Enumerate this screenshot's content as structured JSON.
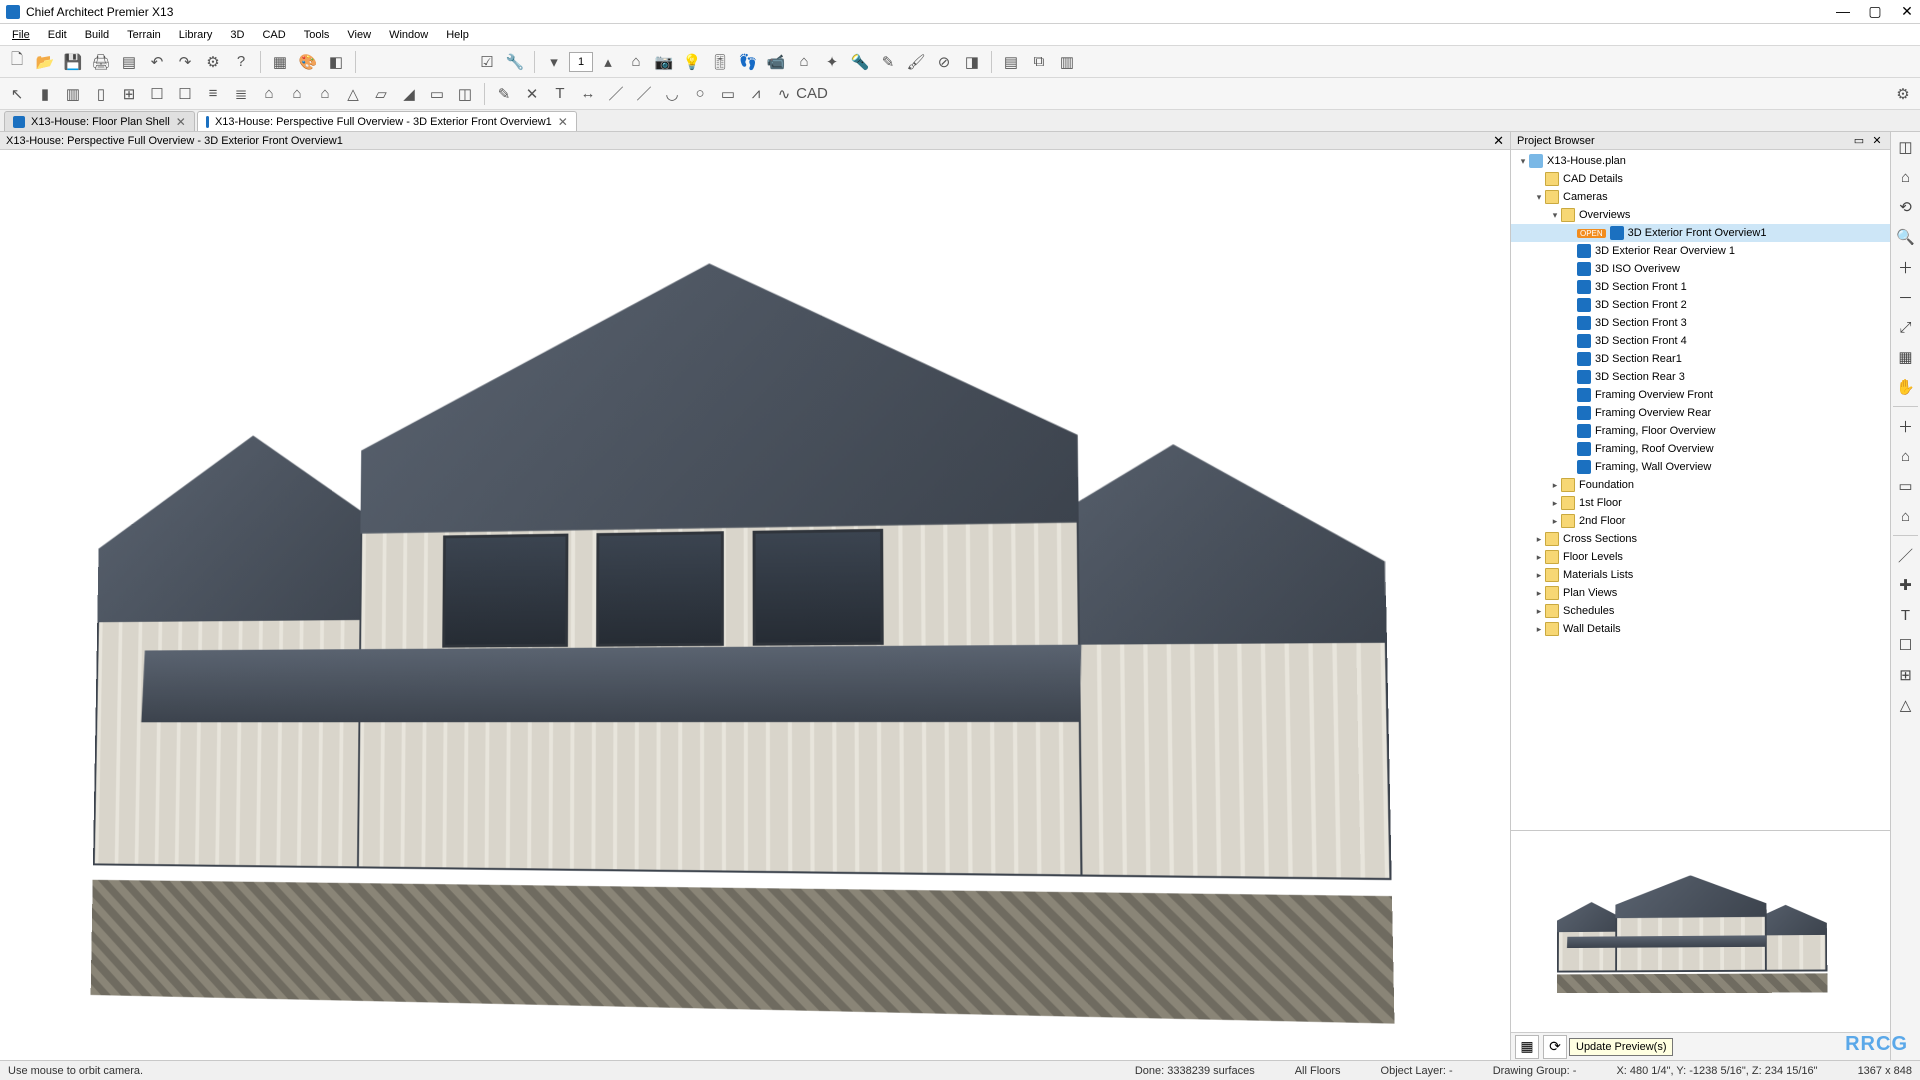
{
  "app": {
    "title": "Chief Architect Premier X13"
  },
  "window_controls": {
    "min": "—",
    "max": "▢",
    "close": "✕"
  },
  "menu": [
    "File",
    "Edit",
    "Build",
    "Terrain",
    "Library",
    "3D",
    "CAD",
    "Tools",
    "View",
    "Window",
    "Help"
  ],
  "toolbar1_left": [
    "file-new-icon",
    "file-open-icon",
    "save-icon",
    "print-icon",
    "page-setup-icon",
    "undo-icon",
    "redo-icon",
    "preferences-icon",
    "help-icon"
  ],
  "toolbar1_mid": [
    "layer-icon",
    "palette-icon",
    "materials-icon"
  ],
  "toolbar1_right1": [
    "checkbox-icon",
    "wrench-icon"
  ],
  "toolbar1_right2": [
    "down-arrow-icon"
  ],
  "floor_value": "1",
  "toolbar1_right3": [
    "up-arrow-icon",
    "house-icon",
    "camera-icon",
    "bulb-icon",
    "slider-icon",
    "feet-icon",
    "camera2-icon",
    "house-outline-icon",
    "bulb2-icon",
    "flashlight-icon",
    "eyedropper-icon",
    "paintbrush-icon",
    "no-icon",
    "eraser-icon"
  ],
  "toolbar1_far": [
    "layout-toggle-icon",
    "image-icon",
    "panel-icon"
  ],
  "toolbar2": [
    "pointer-icon",
    "wall-icon",
    "room-icon",
    "door-icon",
    "window-icon",
    "cabinet-icon",
    "cabinet2-icon",
    "fence-icon",
    "stairs-icon",
    "house-build-icon",
    "house2-icon",
    "house3-icon",
    "roof-icon",
    "plane-icon",
    "roof2-icon",
    "foundation-icon",
    "cube-icon"
  ],
  "toolbar2_draw": [
    "pencil-icon",
    "compass-icon",
    "text-icon",
    "dim-icon",
    "line-icon",
    "line2-icon",
    "arc-icon",
    "circle-icon",
    "rect-icon",
    "polyline-icon",
    "spline-icon",
    "cadblock-icon"
  ],
  "toolbar2_far": [
    "gear-icon"
  ],
  "tabs": [
    {
      "label": "X13-House: Floor Plan Shell",
      "active": false
    },
    {
      "label": "X13-House: Perspective Full Overview - 3D Exterior Front Overview1",
      "active": true
    }
  ],
  "view_title": "X13-House: Perspective Full Overview - 3D Exterior Front Overview1",
  "project_browser": {
    "title": "Project Browser",
    "root": "X13-House.plan",
    "nodes": [
      {
        "label": "CAD Details",
        "icon": "folder",
        "indent": 1,
        "exp": ""
      },
      {
        "label": "Cameras",
        "icon": "folder",
        "indent": 1,
        "exp": "▾"
      },
      {
        "label": "Overviews",
        "icon": "folder",
        "indent": 2,
        "exp": "▾"
      },
      {
        "label": "3D Exterior Front Overview1",
        "icon": "cam",
        "indent": 3,
        "open": true,
        "selected": true
      },
      {
        "label": "3D Exterior Rear Overview 1",
        "icon": "cam",
        "indent": 3
      },
      {
        "label": "3D ISO Overivew",
        "icon": "cam",
        "indent": 3
      },
      {
        "label": "3D Section Front 1",
        "icon": "cam",
        "indent": 3
      },
      {
        "label": "3D Section Front 2",
        "icon": "cam",
        "indent": 3
      },
      {
        "label": "3D Section Front 3",
        "icon": "cam",
        "indent": 3
      },
      {
        "label": "3D Section Front 4",
        "icon": "cam",
        "indent": 3
      },
      {
        "label": "3D Section Rear1",
        "icon": "cam",
        "indent": 3
      },
      {
        "label": "3D Section Rear 3",
        "icon": "cam",
        "indent": 3
      },
      {
        "label": "Framing Overview Front",
        "icon": "cam",
        "indent": 3
      },
      {
        "label": "Framing Overview Rear",
        "icon": "cam",
        "indent": 3
      },
      {
        "label": "Framing, Floor Overview",
        "icon": "cam",
        "indent": 3
      },
      {
        "label": "Framing, Roof Overview",
        "icon": "cam",
        "indent": 3
      },
      {
        "label": "Framing, Wall Overview",
        "icon": "cam",
        "indent": 3
      },
      {
        "label": "Foundation",
        "icon": "folder",
        "indent": 2,
        "exp": "▸"
      },
      {
        "label": "1st Floor",
        "icon": "folder",
        "indent": 2,
        "exp": "▸"
      },
      {
        "label": "2nd Floor",
        "icon": "folder",
        "indent": 2,
        "exp": "▸"
      },
      {
        "label": "Cross Sections",
        "icon": "folder",
        "indent": 1,
        "exp": "▸"
      },
      {
        "label": "Floor Levels",
        "icon": "folder",
        "indent": 1,
        "exp": "▸"
      },
      {
        "label": "Materials Lists",
        "icon": "folder",
        "indent": 1,
        "exp": "▸"
      },
      {
        "label": "Plan Views",
        "icon": "folder",
        "indent": 1,
        "exp": "▸"
      },
      {
        "label": "Schedules",
        "icon": "folder",
        "indent": 1,
        "exp": "▸"
      },
      {
        "label": "Wall Details",
        "icon": "folder",
        "indent": 1,
        "exp": "▸"
      }
    ]
  },
  "preview_tooltip": "Update Preview(s)",
  "side_icons_top": [
    "cube3d-icon",
    "home3d-icon",
    "orbit-icon",
    "search-zoom-icon",
    "zoom-in-icon",
    "zoom-out-icon",
    "measure-diag-icon",
    "wall-surface-icon",
    "hand-pan-icon"
  ],
  "side_icons_mid": [
    "plus-icon",
    "home-fill-icon",
    "blank-icon",
    "home-badge-icon"
  ],
  "side_icons_bot": [
    "line-tool-icon",
    "cross-icon",
    "text-tool-icon",
    "box-icon",
    "grid-icon",
    "triangle-icon"
  ],
  "status": {
    "hint": "Use mouse to orbit camera.",
    "done": "Done:   3338239 surfaces",
    "floors": "All Floors",
    "layer": "Object Layer:  -",
    "group": "Drawing Group:  -",
    "coords": "X: 480 1/4\", Y: -1238 5/16\", Z: 234 15/16\"",
    "dims": "1367 x 848"
  },
  "watermark": "RRCG"
}
